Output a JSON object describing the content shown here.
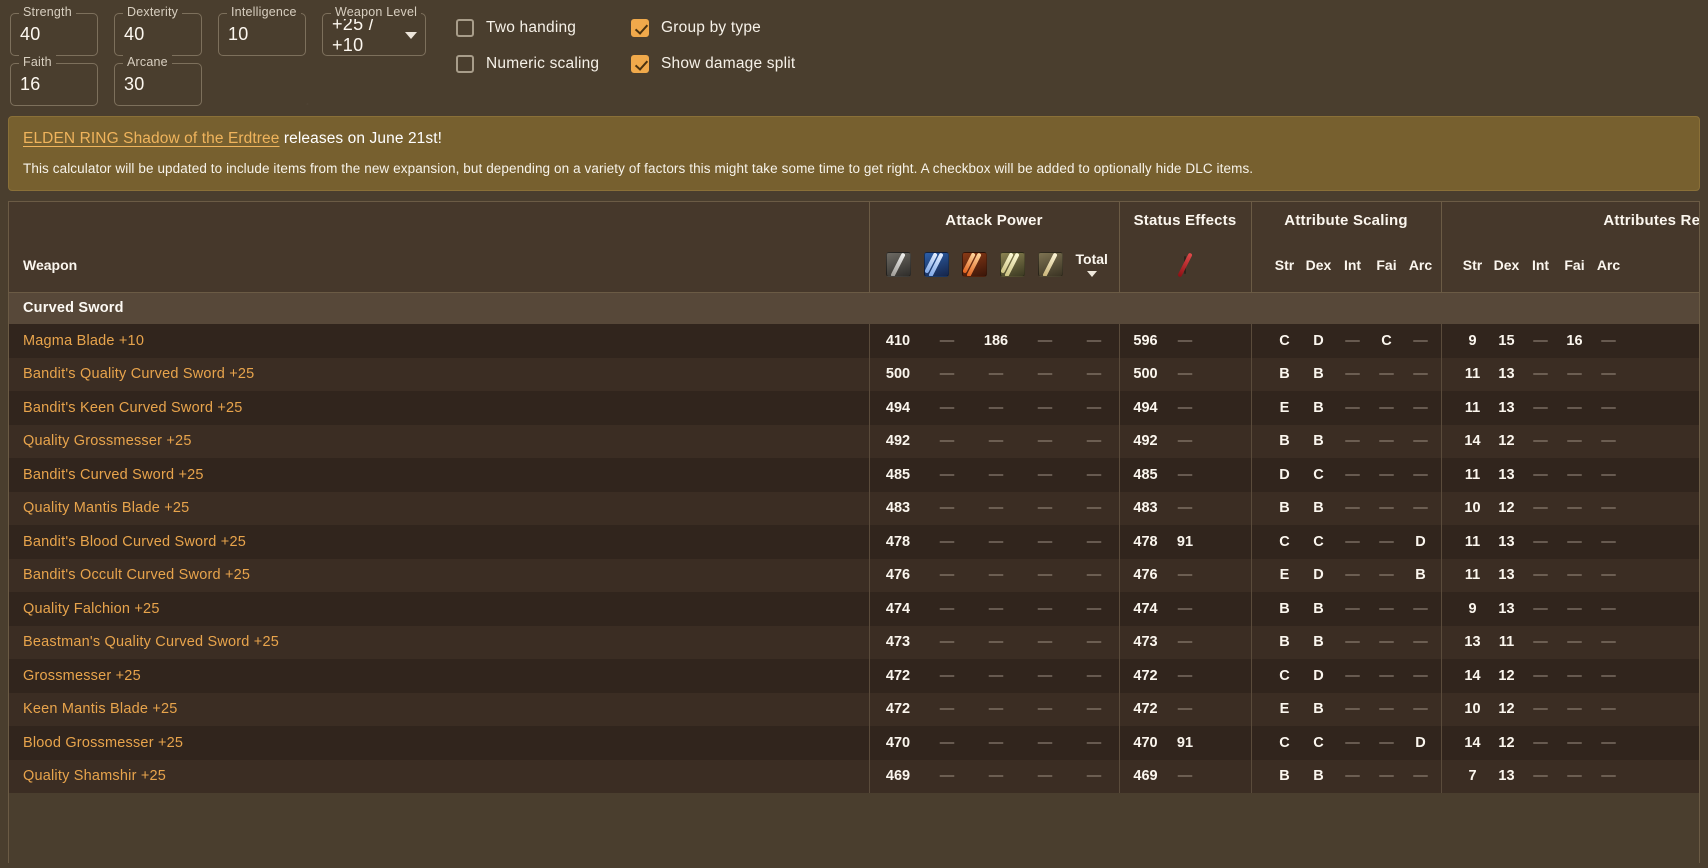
{
  "controls": {
    "stats": [
      {
        "label": "Strength",
        "value": "40"
      },
      {
        "label": "Dexterity",
        "value": "40"
      },
      {
        "label": "Intelligence",
        "value": "10"
      },
      {
        "label": "Weapon Level",
        "value": "+25 / +10"
      },
      {
        "label": "Faith",
        "value": "16"
      },
      {
        "label": "Arcane",
        "value": "30"
      }
    ],
    "checkboxes": [
      {
        "label": "Two handing",
        "checked": false
      },
      {
        "label": "Group by type",
        "checked": true
      },
      {
        "label": "Numeric scaling",
        "checked": false
      },
      {
        "label": "Show damage split",
        "checked": true
      }
    ]
  },
  "banner": {
    "highlight": "ELDEN RING Shadow of the Erdtree",
    "headline_rest": " releases on June 21st!",
    "body": "This calculator will be updated to include items from the new expansion, but depending on a variety of factors this might take some time to get right. A checkbox will be added to optionally hide DLC items."
  },
  "table": {
    "group_headers": {
      "weapon": "",
      "attack_power": "Attack Power",
      "status_effects": "Status Effects",
      "attribute_scaling": "Attribute Scaling",
      "attributes_required": "Attributes Required"
    },
    "sub_headers": {
      "weapon": "Weapon",
      "total": "Total",
      "damage_icons": [
        "physical-damage-icon",
        "magic-damage-icon",
        "fire-damage-icon",
        "lightning-damage-icon",
        "holy-damage-icon"
      ],
      "status_icon": "bleed-status-icon",
      "scaling": [
        "Str",
        "Dex",
        "Int",
        "Fai",
        "Arc"
      ],
      "required": [
        "Str",
        "Dex",
        "Int",
        "Fai",
        "Arc"
      ]
    },
    "category": "Curved Sword",
    "rows": [
      {
        "name": "Magma Blade +10",
        "ap": [
          "410",
          "—",
          "186",
          "—",
          "—"
        ],
        "total": "596",
        "status": "—",
        "scaling": [
          "C",
          "D",
          "—",
          "C",
          "—"
        ],
        "required": [
          "9",
          "15",
          "—",
          "16",
          "—"
        ]
      },
      {
        "name": "Bandit's Quality Curved Sword +25",
        "ap": [
          "500",
          "—",
          "—",
          "—",
          "—"
        ],
        "total": "500",
        "status": "—",
        "scaling": [
          "B",
          "B",
          "—",
          "—",
          "—"
        ],
        "required": [
          "11",
          "13",
          "—",
          "—",
          "—"
        ]
      },
      {
        "name": "Bandit's Keen Curved Sword +25",
        "ap": [
          "494",
          "—",
          "—",
          "—",
          "—"
        ],
        "total": "494",
        "status": "—",
        "scaling": [
          "E",
          "B",
          "—",
          "—",
          "—"
        ],
        "required": [
          "11",
          "13",
          "—",
          "—",
          "—"
        ]
      },
      {
        "name": "Quality Grossmesser +25",
        "ap": [
          "492",
          "—",
          "—",
          "—",
          "—"
        ],
        "total": "492",
        "status": "—",
        "scaling": [
          "B",
          "B",
          "—",
          "—",
          "—"
        ],
        "required": [
          "14",
          "12",
          "—",
          "—",
          "—"
        ]
      },
      {
        "name": "Bandit's Curved Sword +25",
        "ap": [
          "485",
          "—",
          "—",
          "—",
          "—"
        ],
        "total": "485",
        "status": "—",
        "scaling": [
          "D",
          "C",
          "—",
          "—",
          "—"
        ],
        "required": [
          "11",
          "13",
          "—",
          "—",
          "—"
        ]
      },
      {
        "name": "Quality Mantis Blade +25",
        "ap": [
          "483",
          "—",
          "—",
          "—",
          "—"
        ],
        "total": "483",
        "status": "—",
        "scaling": [
          "B",
          "B",
          "—",
          "—",
          "—"
        ],
        "required": [
          "10",
          "12",
          "—",
          "—",
          "—"
        ]
      },
      {
        "name": "Bandit's Blood Curved Sword +25",
        "ap": [
          "478",
          "—",
          "—",
          "—",
          "—"
        ],
        "total": "478",
        "status": "91",
        "scaling": [
          "C",
          "C",
          "—",
          "—",
          "D"
        ],
        "required": [
          "11",
          "13",
          "—",
          "—",
          "—"
        ]
      },
      {
        "name": "Bandit's Occult Curved Sword +25",
        "ap": [
          "476",
          "—",
          "—",
          "—",
          "—"
        ],
        "total": "476",
        "status": "—",
        "scaling": [
          "E",
          "D",
          "—",
          "—",
          "B"
        ],
        "required": [
          "11",
          "13",
          "—",
          "—",
          "—"
        ]
      },
      {
        "name": "Quality Falchion +25",
        "ap": [
          "474",
          "—",
          "—",
          "—",
          "—"
        ],
        "total": "474",
        "status": "—",
        "scaling": [
          "B",
          "B",
          "—",
          "—",
          "—"
        ],
        "required": [
          "9",
          "13",
          "—",
          "—",
          "—"
        ]
      },
      {
        "name": "Beastman's Quality Curved Sword +25",
        "ap": [
          "473",
          "—",
          "—",
          "—",
          "—"
        ],
        "total": "473",
        "status": "—",
        "scaling": [
          "B",
          "B",
          "—",
          "—",
          "—"
        ],
        "required": [
          "13",
          "11",
          "—",
          "—",
          "—"
        ]
      },
      {
        "name": "Grossmesser +25",
        "ap": [
          "472",
          "—",
          "—",
          "—",
          "—"
        ],
        "total": "472",
        "status": "—",
        "scaling": [
          "C",
          "D",
          "—",
          "—",
          "—"
        ],
        "required": [
          "14",
          "12",
          "—",
          "—",
          "—"
        ]
      },
      {
        "name": "Keen Mantis Blade +25",
        "ap": [
          "472",
          "—",
          "—",
          "—",
          "—"
        ],
        "total": "472",
        "status": "—",
        "scaling": [
          "E",
          "B",
          "—",
          "—",
          "—"
        ],
        "required": [
          "10",
          "12",
          "—",
          "—",
          "—"
        ]
      },
      {
        "name": "Blood Grossmesser +25",
        "ap": [
          "470",
          "—",
          "—",
          "—",
          "—"
        ],
        "total": "470",
        "status": "91",
        "scaling": [
          "C",
          "C",
          "—",
          "—",
          "D"
        ],
        "required": [
          "14",
          "12",
          "—",
          "—",
          "—"
        ]
      },
      {
        "name": "Quality Shamshir +25",
        "ap": [
          "469",
          "—",
          "—",
          "—",
          "—"
        ],
        "total": "469",
        "status": "—",
        "scaling": [
          "B",
          "B",
          "—",
          "—",
          "—"
        ],
        "required": [
          "7",
          "13",
          "—",
          "—",
          "—"
        ]
      }
    ]
  },
  "colors": {
    "accent": "#e8a44c",
    "banner_bg": "#77602f",
    "page_bg": "#4a3e2e",
    "checkbox_on": "#f0a94b"
  }
}
